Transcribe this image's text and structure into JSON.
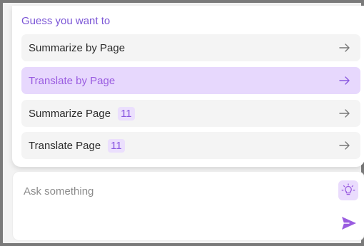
{
  "suggestions_panel": {
    "title": "Guess you want to",
    "items": [
      {
        "label": "Summarize by Page",
        "badge": "",
        "active": false,
        "icon": "arrow-right-icon"
      },
      {
        "label": "Translate by Page",
        "badge": "",
        "active": true,
        "icon": "arrow-right-icon"
      },
      {
        "label": "Summarize Page",
        "badge": "11",
        "active": false,
        "icon": "arrow-right-icon"
      },
      {
        "label": "Translate Page",
        "badge": "11",
        "active": false,
        "icon": "arrow-right-icon"
      }
    ]
  },
  "ask_box": {
    "placeholder": "Ask something",
    "value": "",
    "idea_icon": "lightbulb-icon",
    "send_icon": "send-icon"
  },
  "colors": {
    "accent": "#9a5ce0",
    "title": "#7b55d6",
    "active_bg": "#e7d8fd",
    "badge_bg": "#ebdffd",
    "item_bg": "#f4f4f4"
  }
}
